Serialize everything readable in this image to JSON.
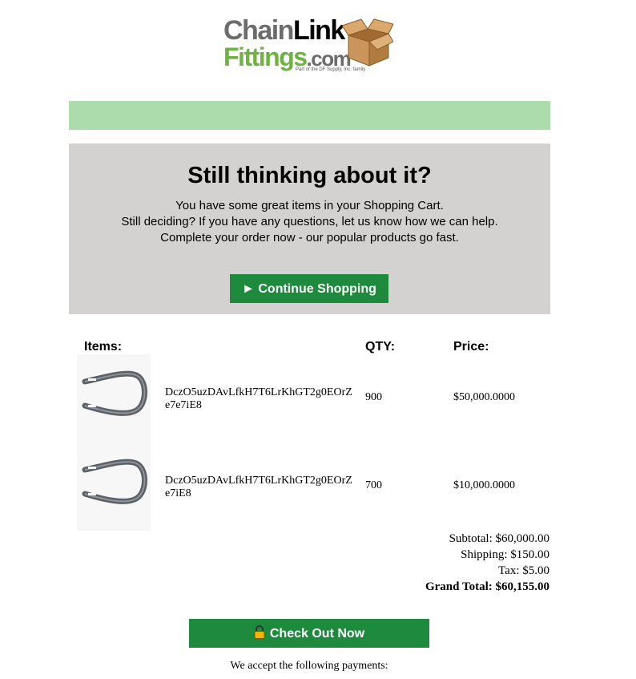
{
  "header": {
    "logo_word_1a": "Chain",
    "logo_word_1b": "Link",
    "logo_word_2": "Fittings",
    "logo_word_3": ".com",
    "logo_tagline": "Part of the DF Supply, Inc. family"
  },
  "promo": {
    "title": "Still thinking about it?",
    "lines": [
      "You have some great items in your Shopping Cart.",
      "Still deciding? If you have any questions, let us know how we can help.",
      "Complete your order now - our popular products go fast."
    ],
    "button_label": "► Continue Shopping"
  },
  "cart": {
    "headers": {
      "items": "Items:",
      "qty": "QTY:",
      "price": "Price:"
    },
    "rows": [
      {
        "name": "DczO5uzDAvLfkH7T6LrKhGT2g0EOrZe7e7iE8",
        "qty": "900",
        "price": "$50,000.0000"
      },
      {
        "name": "DczO5uzDAvLfkH7T6LrKhGT2g0EOrZe7iE8",
        "qty": "700",
        "price": "$10,000.0000"
      }
    ]
  },
  "totals": {
    "subtotal": "Subtotal: $60,000.00",
    "shipping": "Shipping: $150.00",
    "tax": "Tax: $5.00",
    "grand_total": "Grand Total: $60,155.00"
  },
  "checkout": {
    "button_label": "Check Out Now"
  },
  "footer": {
    "payments_text": "We accept the following payments:"
  },
  "colors": {
    "green_bar": "#acdcac",
    "promo_bg": "#d3d2d1",
    "button_green": "#1e8a3e",
    "logo_green": "#6cb33f"
  },
  "icons": [
    "cardboard-box-icon",
    "lock-icon",
    "play-icon"
  ]
}
